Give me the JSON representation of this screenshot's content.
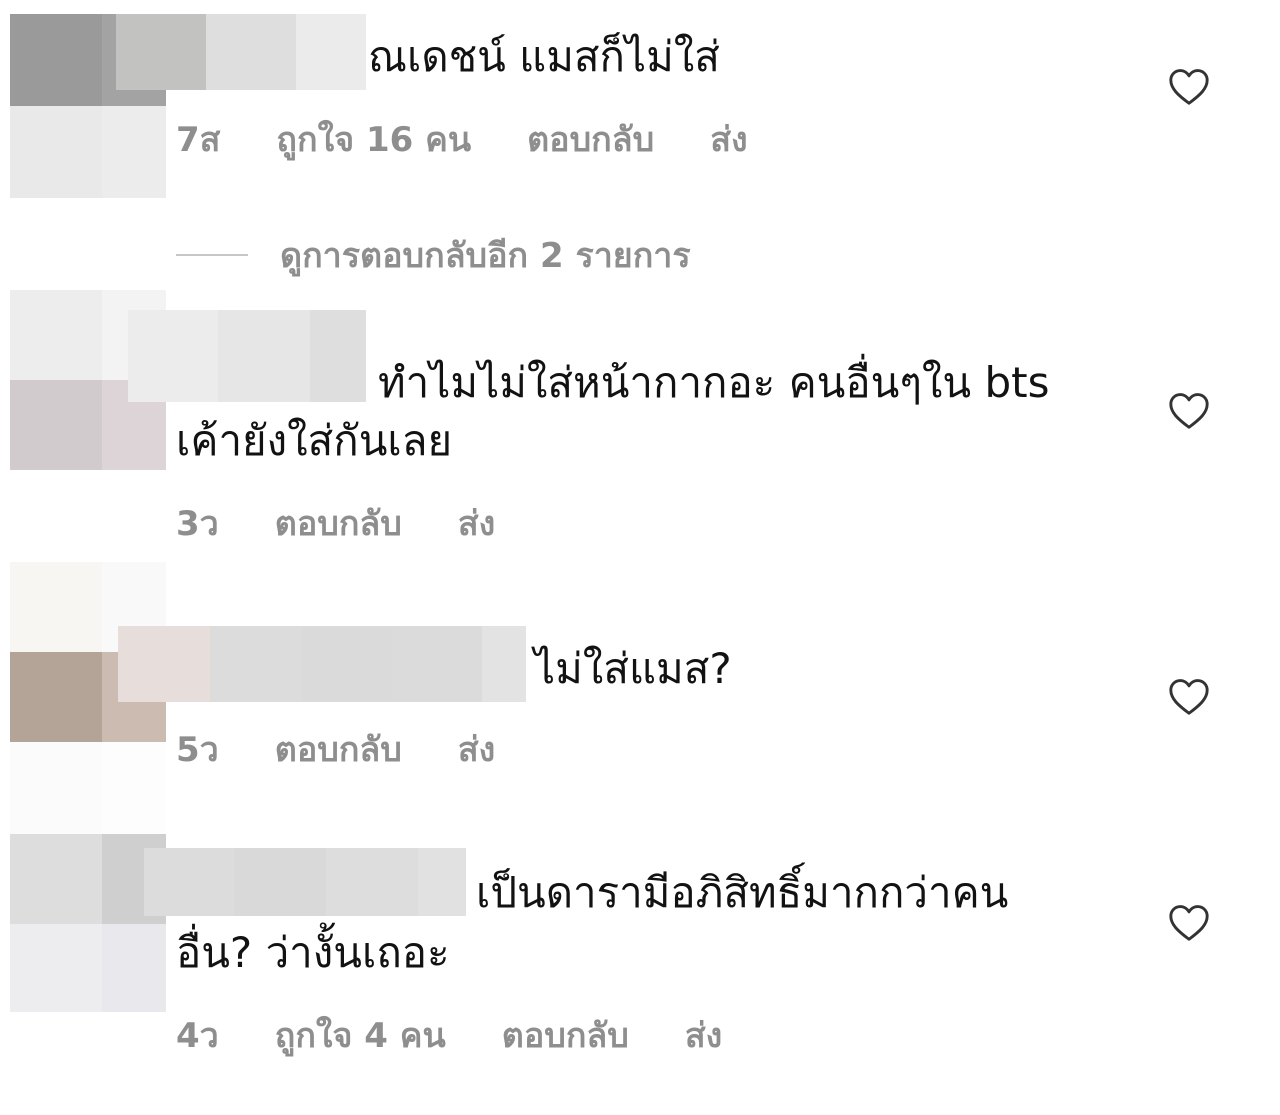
{
  "comments": [
    {
      "text_line1": "ณเดชน์  แมสก็ไม่ใส่",
      "text_line2": "",
      "time": "7ส",
      "likes": "ถูกใจ 16 คน",
      "reply": "ตอบกลับ",
      "send": "ส่ง"
    },
    {
      "text_line1": "ทำไมไม่ใส่หน้ากากอะ คนอื่นๆใน bts",
      "text_line2": "เค้ายังใส่กันเลย",
      "time": "3ว",
      "likes": "",
      "reply": "ตอบกลับ",
      "send": "ส่ง"
    },
    {
      "text_line1": "ไม่ใส่แมส?",
      "text_line2": "",
      "time": "5ว",
      "likes": "",
      "reply": "ตอบกลับ",
      "send": "ส่ง"
    },
    {
      "text_line1": "เป็นดารามีอภิสิทธิ์มากกว่าคน",
      "text_line2": "อื่น? ว่างั้นเถอะ",
      "time": "4ว",
      "likes": "ถูกใจ 4 คน",
      "reply": "ตอบกลับ",
      "send": "ส่ง"
    }
  ],
  "view_replies_label": "ดูการตอบกลับอีก 2 รายการ",
  "icons": {
    "like": "heart-outline-icon"
  },
  "colors": {
    "text": "#121212",
    "meta": "#8e8e8e",
    "background": "#ffffff"
  }
}
